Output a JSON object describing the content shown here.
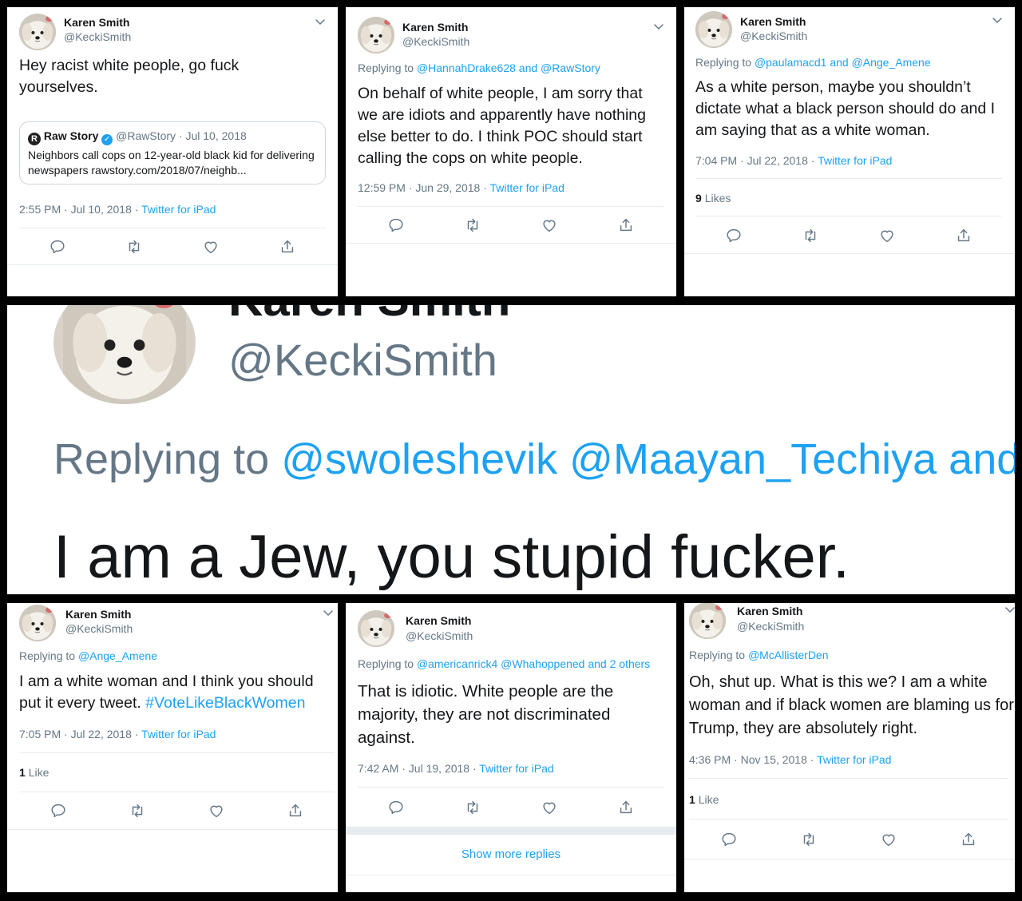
{
  "author": {
    "name": "Karen Smith",
    "handle": "@KeckiSmith"
  },
  "colors": {
    "link": "#1da1f2",
    "muted": "#657786",
    "text": "#14171a",
    "background": "#000000"
  },
  "icons": {
    "reply": "reply-icon",
    "retweet": "retweet-icon",
    "like": "heart-icon",
    "share": "share-icon",
    "menu": "chevron-down-icon"
  },
  "tweet1": {
    "text": "Hey racist white people, go fuck yourselves.",
    "quote": {
      "source_name": "Raw Story",
      "source_handle": "@RawStory",
      "date": "· Jul 10, 2018",
      "text": "Neighbors call cops on 12-year-old black kid for delivering newspapers rawstory.com/2018/07/neighb..."
    },
    "time": "2:55 PM · Jul 10, 2018 ·",
    "client": "Twitter for iPad"
  },
  "tweet2": {
    "reply_label": "Replying to",
    "reply_to": "@HannahDrake628 and @RawStory",
    "text": "On behalf of white people, I am sorry that we are idiots and apparently have nothing else better to do.  I think POC should start calling the cops on white people.",
    "time": "12:59 PM · Jun 29, 2018 ·",
    "client": "Twitter for iPad"
  },
  "tweet3": {
    "reply_label": "Replying to",
    "reply_to": "@paulamacd1 and @Ange_Amene",
    "text": "As a white person, maybe you shouldn’t dictate what a black person should do and I am saying that as a white woman.",
    "time": "7:04 PM · Jul 22, 2018 ·",
    "client": "Twitter for iPad",
    "likes_count": "9",
    "likes_label": "Likes"
  },
  "zoom": {
    "name": "Karen Smith",
    "handle": "@KeckiSmith",
    "reply_label": "Replying to",
    "reply_to": "@swoleshevik @Maayan_Techiya and",
    "text": "I am a Jew, you stupid fucker."
  },
  "tweet4": {
    "reply_label": "Replying to",
    "reply_to": "@Ange_Amene",
    "text": "I am a white woman and I think you should put it every tweet.",
    "hashtag": "#VoteLikeBlackWomen",
    "time": "7:05 PM · Jul 22, 2018 ·",
    "client": "Twitter for iPad",
    "likes_count": "1",
    "likes_label": "Like"
  },
  "tweet5": {
    "reply_label": "Replying to",
    "reply_to": "@americanrick4 @Whahoppened and 2 others",
    "text": "That is idiotic.  White people are the majority, they are not discriminated against.",
    "time": "7:42 AM · Jul 19, 2018 ·",
    "client": "Twitter for iPad",
    "more": "Show more replies"
  },
  "tweet6": {
    "reply_label": "Replying to",
    "reply_to": "@McAllisterDen",
    "text": "Oh, shut up.  What is this we?  I am a white woman and if black women are blaming us for Trump, they are absolutely right.",
    "time": "4:36 PM · Nov 15, 2018 ·",
    "client": "Twitter for iPad",
    "likes_count": "1",
    "likes_label": "Like"
  }
}
